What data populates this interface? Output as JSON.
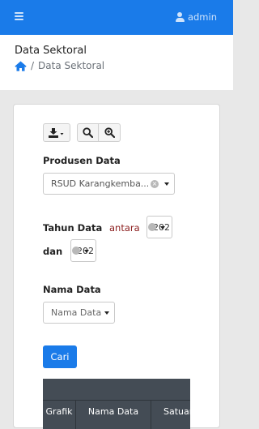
{
  "topbar": {
    "menu_icon": "hamburger-icon",
    "user_icon": "user-icon",
    "username": "admin",
    "color": "#1a7be9"
  },
  "header": {
    "title": "Data Sektoral",
    "breadcrumb": {
      "home_icon": "home-icon",
      "separator": "/",
      "current": "Data Sektoral"
    }
  },
  "toolbar": {
    "export_icon": "download-icon",
    "zoom_out_icon": "search-icon",
    "zoom_in_icon": "zoom-in-icon"
  },
  "form": {
    "produsen_label": "Produsen Data",
    "produsen_value": "RSUD Karangkemba...",
    "tahun_label": "Tahun Data",
    "antara": "antara",
    "tahun_from": "202",
    "dan": "dan",
    "tahun_to": "202",
    "nama_label": "Nama Data",
    "nama_placeholder": "Nama Data",
    "submit": "Cari"
  },
  "table": {
    "columns": [
      "Grafik",
      "Nama Data",
      "Satuan"
    ]
  }
}
